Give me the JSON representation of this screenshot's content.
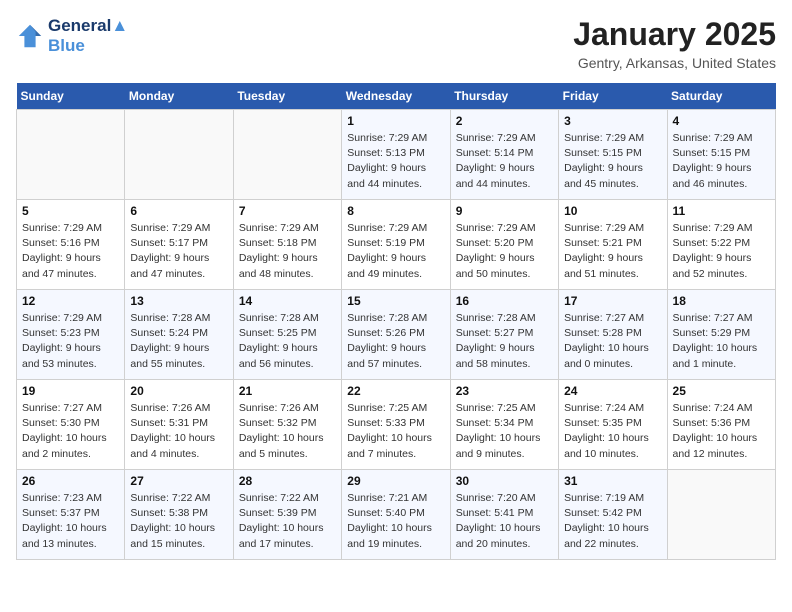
{
  "header": {
    "logo_line1": "General",
    "logo_line2": "Blue",
    "month_title": "January 2025",
    "location": "Gentry, Arkansas, United States"
  },
  "weekdays": [
    "Sunday",
    "Monday",
    "Tuesday",
    "Wednesday",
    "Thursday",
    "Friday",
    "Saturday"
  ],
  "weeks": [
    [
      {
        "day": "",
        "detail": ""
      },
      {
        "day": "",
        "detail": ""
      },
      {
        "day": "",
        "detail": ""
      },
      {
        "day": "1",
        "detail": "Sunrise: 7:29 AM\nSunset: 5:13 PM\nDaylight: 9 hours\nand 44 minutes."
      },
      {
        "day": "2",
        "detail": "Sunrise: 7:29 AM\nSunset: 5:14 PM\nDaylight: 9 hours\nand 44 minutes."
      },
      {
        "day": "3",
        "detail": "Sunrise: 7:29 AM\nSunset: 5:15 PM\nDaylight: 9 hours\nand 45 minutes."
      },
      {
        "day": "4",
        "detail": "Sunrise: 7:29 AM\nSunset: 5:15 PM\nDaylight: 9 hours\nand 46 minutes."
      }
    ],
    [
      {
        "day": "5",
        "detail": "Sunrise: 7:29 AM\nSunset: 5:16 PM\nDaylight: 9 hours\nand 47 minutes."
      },
      {
        "day": "6",
        "detail": "Sunrise: 7:29 AM\nSunset: 5:17 PM\nDaylight: 9 hours\nand 47 minutes."
      },
      {
        "day": "7",
        "detail": "Sunrise: 7:29 AM\nSunset: 5:18 PM\nDaylight: 9 hours\nand 48 minutes."
      },
      {
        "day": "8",
        "detail": "Sunrise: 7:29 AM\nSunset: 5:19 PM\nDaylight: 9 hours\nand 49 minutes."
      },
      {
        "day": "9",
        "detail": "Sunrise: 7:29 AM\nSunset: 5:20 PM\nDaylight: 9 hours\nand 50 minutes."
      },
      {
        "day": "10",
        "detail": "Sunrise: 7:29 AM\nSunset: 5:21 PM\nDaylight: 9 hours\nand 51 minutes."
      },
      {
        "day": "11",
        "detail": "Sunrise: 7:29 AM\nSunset: 5:22 PM\nDaylight: 9 hours\nand 52 minutes."
      }
    ],
    [
      {
        "day": "12",
        "detail": "Sunrise: 7:29 AM\nSunset: 5:23 PM\nDaylight: 9 hours\nand 53 minutes."
      },
      {
        "day": "13",
        "detail": "Sunrise: 7:28 AM\nSunset: 5:24 PM\nDaylight: 9 hours\nand 55 minutes."
      },
      {
        "day": "14",
        "detail": "Sunrise: 7:28 AM\nSunset: 5:25 PM\nDaylight: 9 hours\nand 56 minutes."
      },
      {
        "day": "15",
        "detail": "Sunrise: 7:28 AM\nSunset: 5:26 PM\nDaylight: 9 hours\nand 57 minutes."
      },
      {
        "day": "16",
        "detail": "Sunrise: 7:28 AM\nSunset: 5:27 PM\nDaylight: 9 hours\nand 58 minutes."
      },
      {
        "day": "17",
        "detail": "Sunrise: 7:27 AM\nSunset: 5:28 PM\nDaylight: 10 hours\nand 0 minutes."
      },
      {
        "day": "18",
        "detail": "Sunrise: 7:27 AM\nSunset: 5:29 PM\nDaylight: 10 hours\nand 1 minute."
      }
    ],
    [
      {
        "day": "19",
        "detail": "Sunrise: 7:27 AM\nSunset: 5:30 PM\nDaylight: 10 hours\nand 2 minutes."
      },
      {
        "day": "20",
        "detail": "Sunrise: 7:26 AM\nSunset: 5:31 PM\nDaylight: 10 hours\nand 4 minutes."
      },
      {
        "day": "21",
        "detail": "Sunrise: 7:26 AM\nSunset: 5:32 PM\nDaylight: 10 hours\nand 5 minutes."
      },
      {
        "day": "22",
        "detail": "Sunrise: 7:25 AM\nSunset: 5:33 PM\nDaylight: 10 hours\nand 7 minutes."
      },
      {
        "day": "23",
        "detail": "Sunrise: 7:25 AM\nSunset: 5:34 PM\nDaylight: 10 hours\nand 9 minutes."
      },
      {
        "day": "24",
        "detail": "Sunrise: 7:24 AM\nSunset: 5:35 PM\nDaylight: 10 hours\nand 10 minutes."
      },
      {
        "day": "25",
        "detail": "Sunrise: 7:24 AM\nSunset: 5:36 PM\nDaylight: 10 hours\nand 12 minutes."
      }
    ],
    [
      {
        "day": "26",
        "detail": "Sunrise: 7:23 AM\nSunset: 5:37 PM\nDaylight: 10 hours\nand 13 minutes."
      },
      {
        "day": "27",
        "detail": "Sunrise: 7:22 AM\nSunset: 5:38 PM\nDaylight: 10 hours\nand 15 minutes."
      },
      {
        "day": "28",
        "detail": "Sunrise: 7:22 AM\nSunset: 5:39 PM\nDaylight: 10 hours\nand 17 minutes."
      },
      {
        "day": "29",
        "detail": "Sunrise: 7:21 AM\nSunset: 5:40 PM\nDaylight: 10 hours\nand 19 minutes."
      },
      {
        "day": "30",
        "detail": "Sunrise: 7:20 AM\nSunset: 5:41 PM\nDaylight: 10 hours\nand 20 minutes."
      },
      {
        "day": "31",
        "detail": "Sunrise: 7:19 AM\nSunset: 5:42 PM\nDaylight: 10 hours\nand 22 minutes."
      },
      {
        "day": "",
        "detail": ""
      }
    ]
  ]
}
